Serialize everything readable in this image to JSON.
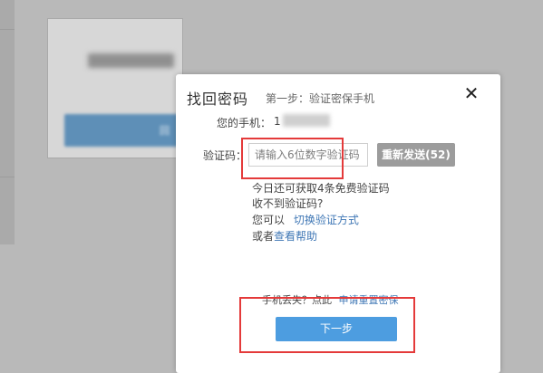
{
  "background": {
    "card_button_text": "回"
  },
  "modal": {
    "title": "找回密码",
    "subtitle": "第一步：验证密保手机",
    "close_symbol": "✕",
    "phone_label": "您的手机：",
    "phone_value": "1",
    "code_label": "验证码：",
    "code_placeholder": "请输入6位数字验证码",
    "resend_label": "重新发送(52)",
    "info_line1": "今日还可获取4条免费验证码",
    "info_line2": "收不到验证码?",
    "info_line3_prefix": "您可以",
    "info_line3_link": "切换验证方式",
    "info_line4_prefix": "或者",
    "info_line4_link": "查看帮助",
    "lost_phone_prefix": "手机丢失？点此",
    "lost_phone_link": "申请重置密保",
    "next_label": "下一步"
  },
  "colors": {
    "accent_blue": "#4d9de0",
    "link_blue": "#3f77b5",
    "highlight_red": "#e43a3a",
    "resend_gray": "#9c9c9c"
  }
}
